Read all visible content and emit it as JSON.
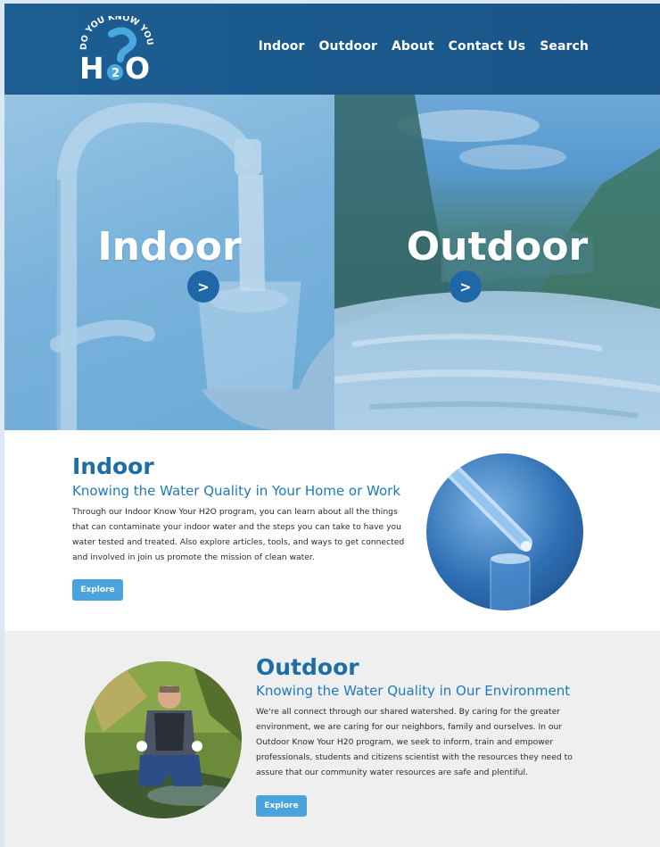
{
  "header": {
    "logo_text_top": "DO YOU KNOW YOUR",
    "logo_text_main": "H2O",
    "nav": [
      "Indoor",
      "Outdoor",
      "About",
      "Contact Us",
      "Search"
    ]
  },
  "hero": {
    "left_title": "Indoor",
    "right_title": "Outdoor",
    "arrow": ">"
  },
  "indoor": {
    "title": "Indoor",
    "subtitle": "Knowing the Water Quality in Your Home or Work",
    "body": "Through our Indoor Know Your H2O program, you can learn about all the things that can contaminate your indoor water and the steps you can take to have you water tested and treated. Also explore articles, tools, and ways to get connected and involved in join us promote the mission of clean water.",
    "button": "Explore"
  },
  "outdoor": {
    "title": "Outdoor",
    "subtitle": "Knowing the Water Quality in Our Environment",
    "body": "We're all connect through our shared watershed. By caring for the greater environment, we are caring for our neighbors, family and ourselves. In our Outdoor Know Your H20 program, we seek to inform, train and empower professionals, students and citizens scientist with the resources they need to assure that our community water resources are safe and plentiful.",
    "button": "Explore"
  },
  "colors": {
    "header": "#1b5a8d",
    "accent": "#1c6ea4",
    "button": "#4ba3dd"
  }
}
